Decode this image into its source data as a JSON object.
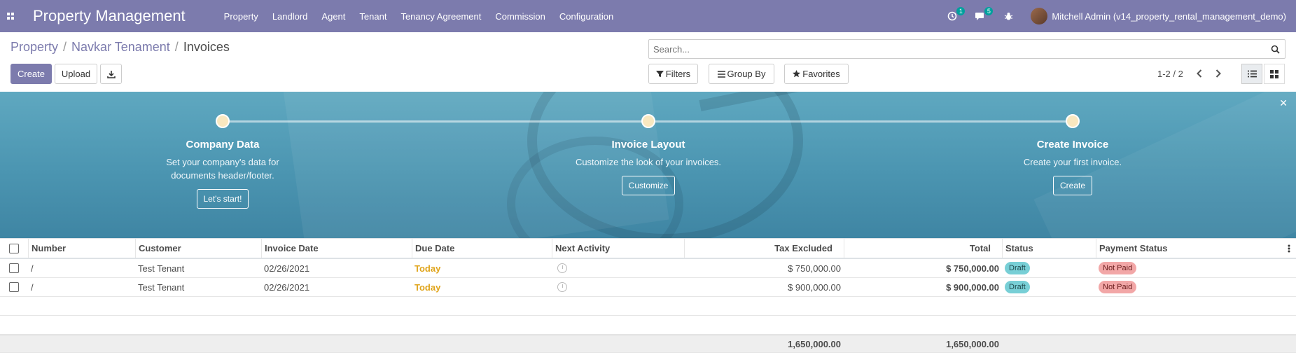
{
  "navbar": {
    "brand": "Property Management",
    "menu": [
      "Property",
      "Landlord",
      "Agent",
      "Tenant",
      "Tenancy Agreement",
      "Commission",
      "Configuration"
    ],
    "activity_count": "1",
    "message_count": "5",
    "user_name": "Mitchell Admin (v14_property_rental_management_demo)"
  },
  "breadcrumb": {
    "items": [
      "Property",
      "Navkar Tenament",
      "Invoices"
    ]
  },
  "toolbar": {
    "create_label": "Create",
    "upload_label": "Upload"
  },
  "search": {
    "placeholder": "Search...",
    "filters_label": "Filters",
    "group_by_label": "Group By",
    "favorites_label": "Favorites"
  },
  "pager": {
    "value": "1-2 / 2"
  },
  "banner": {
    "steps": [
      {
        "title": "Company Data",
        "desc_line1": "Set your company's data for",
        "desc_line2": "documents header/footer.",
        "button": "Let's start!"
      },
      {
        "title": "Invoice Layout",
        "desc_line1": "Customize the look of your invoices.",
        "desc_line2": "",
        "button": "Customize"
      },
      {
        "title": "Create Invoice",
        "desc_line1": "Create your first invoice.",
        "desc_line2": "",
        "button": "Create"
      }
    ]
  },
  "table": {
    "columns": [
      "Number",
      "Customer",
      "Invoice Date",
      "Due Date",
      "Next Activity",
      "Tax Excluded",
      "Total",
      "Status",
      "Payment Status"
    ],
    "rows": [
      {
        "number": "/",
        "customer": "Test Tenant",
        "invoice_date": "02/26/2021",
        "due_date": "Today",
        "tax_excluded": "$ 750,000.00",
        "total": "$ 750,000.00",
        "status": "Draft",
        "payment_status": "Not Paid"
      },
      {
        "number": "/",
        "customer": "Test Tenant",
        "invoice_date": "02/26/2021",
        "due_date": "Today",
        "tax_excluded": "$ 900,000.00",
        "total": "$ 900,000.00",
        "status": "Draft",
        "payment_status": "Not Paid"
      }
    ],
    "totals": {
      "tax_excluded": "1,650,000.00",
      "total": "1,650,000.00"
    }
  },
  "colors": {
    "navbar": "#7c7bad",
    "primary": "#7c7bad",
    "draft_badge": "#78cfd6",
    "not_paid_badge": "#f2a7a7",
    "due_today": "#e0a41a"
  }
}
